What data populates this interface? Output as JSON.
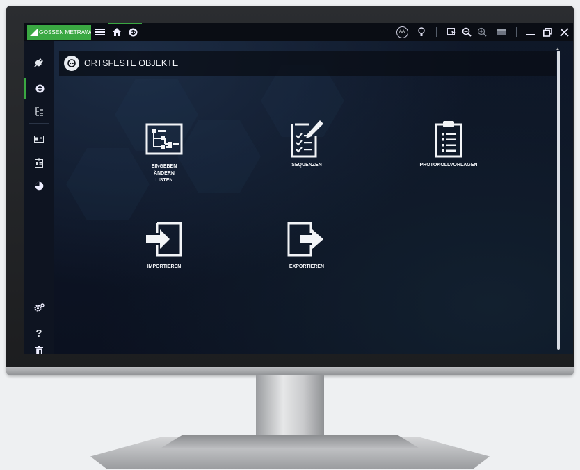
{
  "app": {
    "brand": "GOSSEN METRAWATT",
    "brand_color": "#3aa842"
  },
  "titlebar": {
    "left_icons": [
      "menu-icon",
      "home-icon",
      "socket-icon"
    ],
    "right_icons": [
      "font-size-icon",
      "bulb-icon",
      "select-screen-icon",
      "zoom-out-icon",
      "zoom-in-icon",
      "window-layout-icon",
      "minimize-icon",
      "restore-icon",
      "close-icon"
    ],
    "font_size_label": "AA"
  },
  "sidebar": {
    "items": [
      {
        "icon": "plug-icon"
      },
      {
        "icon": "socket-icon",
        "active": true
      },
      {
        "icon": "tree-icon"
      },
      {
        "icon": "panel-icon"
      },
      {
        "icon": "id-card-icon"
      },
      {
        "icon": "pie-chart-icon"
      },
      {
        "icon": "settings-icon"
      },
      {
        "icon": "help-icon",
        "label": "?"
      },
      {
        "icon": "trash-icon"
      }
    ]
  },
  "main": {
    "title": "ORTSFESTE OBJEKTE",
    "tiles": [
      {
        "name": "eingeben",
        "label": "EINGEBEN\nÄNDERN\nLISTEN",
        "icon": "tree-structure-icon"
      },
      {
        "name": "sequenzen",
        "label": "SEQUENZEN",
        "icon": "checklist-edit-icon"
      },
      {
        "name": "protokollvorlagen",
        "label": "PROTOKOLLVORLAGEN",
        "icon": "clipboard-list-icon"
      },
      {
        "name": "importieren",
        "label": "IMPORTIEREN",
        "icon": "import-icon"
      },
      {
        "name": "exportieren",
        "label": "EXPORTIEREN",
        "icon": "export-icon"
      }
    ]
  }
}
